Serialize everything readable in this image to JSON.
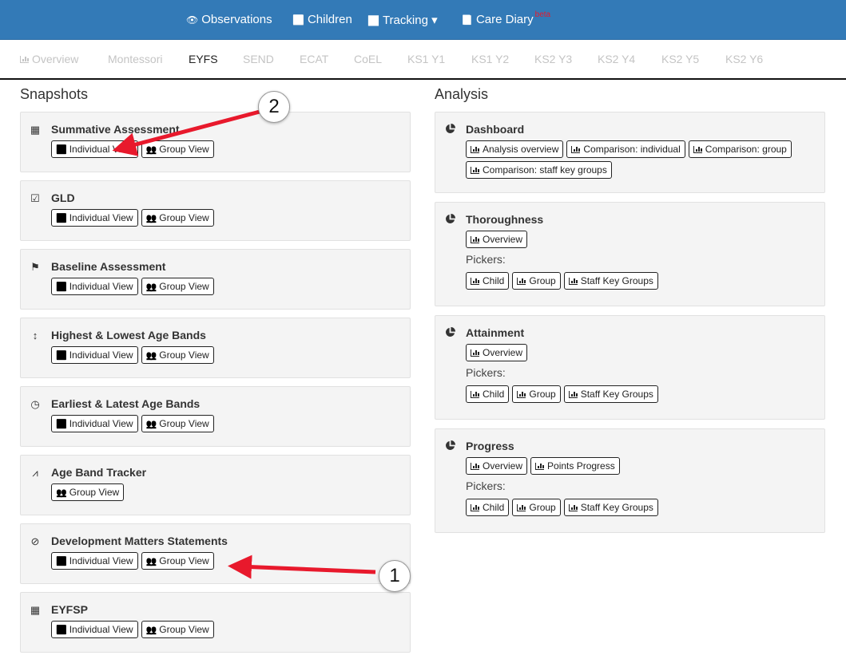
{
  "topnav": [
    {
      "label": "Observations",
      "icon": "eye-icon",
      "glyph": "👁"
    },
    {
      "label": "Children",
      "icon": "child-icon",
      "glyph": "🚹"
    },
    {
      "label": "Tracking",
      "icon": "line-chart-icon",
      "glyph": "📈",
      "caret": "▾"
    },
    {
      "label": "Care Diary",
      "icon": "book-icon",
      "glyph": "📘",
      "badge": "beta"
    }
  ],
  "tabs": [
    "Overview",
    "Montessori",
    "EYFS",
    "SEND",
    "ECAT",
    "CoEL",
    "KS1 Y1",
    "KS1 Y2",
    "KS2 Y3",
    "KS2 Y4",
    "KS2 Y5",
    "KS2 Y6"
  ],
  "active_tab": "EYFS",
  "snapshots": {
    "heading": "Snapshots",
    "panels": [
      {
        "title": "Summative Assessment",
        "icon": "calendar-icon",
        "glyph": "▦",
        "buttons": [
          "Individual View",
          "Group View"
        ]
      },
      {
        "title": "GLD",
        "icon": "calendar-check-icon",
        "glyph": "☑",
        "buttons": [
          "Individual View",
          "Group View"
        ]
      },
      {
        "title": "Baseline Assessment",
        "icon": "flag-icon",
        "glyph": "⚑",
        "buttons": [
          "Individual View",
          "Group View"
        ]
      },
      {
        "title": "Highest & Lowest Age Bands",
        "icon": "vertical-arrows-icon",
        "glyph": "↕",
        "buttons": [
          "Individual View",
          "Group View"
        ]
      },
      {
        "title": "Earliest & Latest Age Bands",
        "icon": "clock-icon",
        "glyph": "◷",
        "buttons": [
          "Individual View",
          "Group View"
        ]
      },
      {
        "title": "Age Band Tracker",
        "icon": "line-chart-icon",
        "glyph": "⩘",
        "buttons": [
          "Group View"
        ]
      },
      {
        "title": "Development Matters Statements",
        "icon": "check-circle-icon",
        "glyph": "⊘",
        "buttons": [
          "Individual View",
          "Group View"
        ]
      },
      {
        "title": "EYFSP",
        "icon": "calendar-icon",
        "glyph": "▦",
        "buttons": [
          "Individual View",
          "Group View"
        ]
      }
    ]
  },
  "analysis": {
    "heading": "Analysis",
    "panels": [
      {
        "title": "Dashboard",
        "buttons": [
          "Analysis overview",
          "Comparison: individual",
          "Comparison: group",
          "Comparison: staff key groups"
        ]
      },
      {
        "title": "Thoroughness",
        "buttons": [
          "Overview"
        ],
        "pickers_label": "Pickers:",
        "pickers": [
          "Child",
          "Group",
          "Staff Key Groups"
        ]
      },
      {
        "title": "Attainment",
        "buttons": [
          "Overview"
        ],
        "pickers_label": "Pickers:",
        "pickers": [
          "Child",
          "Group",
          "Staff Key Groups"
        ]
      },
      {
        "title": "Progress",
        "buttons": [
          "Overview",
          "Points Progress"
        ],
        "pickers_label": "Pickers:",
        "pickers": [
          "Child",
          "Group",
          "Staff Key Groups"
        ]
      }
    ]
  },
  "annotations": [
    "1",
    "2"
  ],
  "colors": {
    "nav": "#337ab7",
    "arrow": "#e8192c"
  }
}
